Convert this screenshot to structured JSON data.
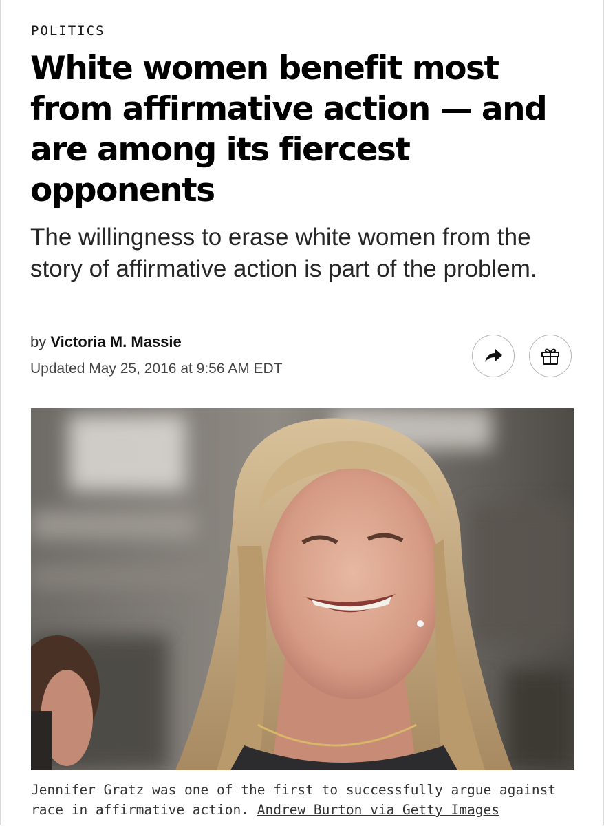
{
  "section": "POLITICS",
  "headline": "White women benefit most from affirmative action — and are among its fiercest opponents",
  "dek": "The willingness to erase white women from the story of affirmative action is part of the problem.",
  "byline": {
    "prefix": "by",
    "author": "Victoria M. Massie",
    "updated": "Updated May 25, 2016 at 9:56 AM EDT"
  },
  "actions": {
    "share_icon": "share-arrow-icon",
    "gift_icon": "gift-icon"
  },
  "photo": {
    "caption": "Jennifer Gratz was one of the first to successfully argue against race in affirmative action.",
    "credit": "Andrew Burton via Getty Images"
  },
  "colors": {
    "text": "#111111",
    "background": "#ffffff",
    "button_border": "#b5b5b5"
  }
}
